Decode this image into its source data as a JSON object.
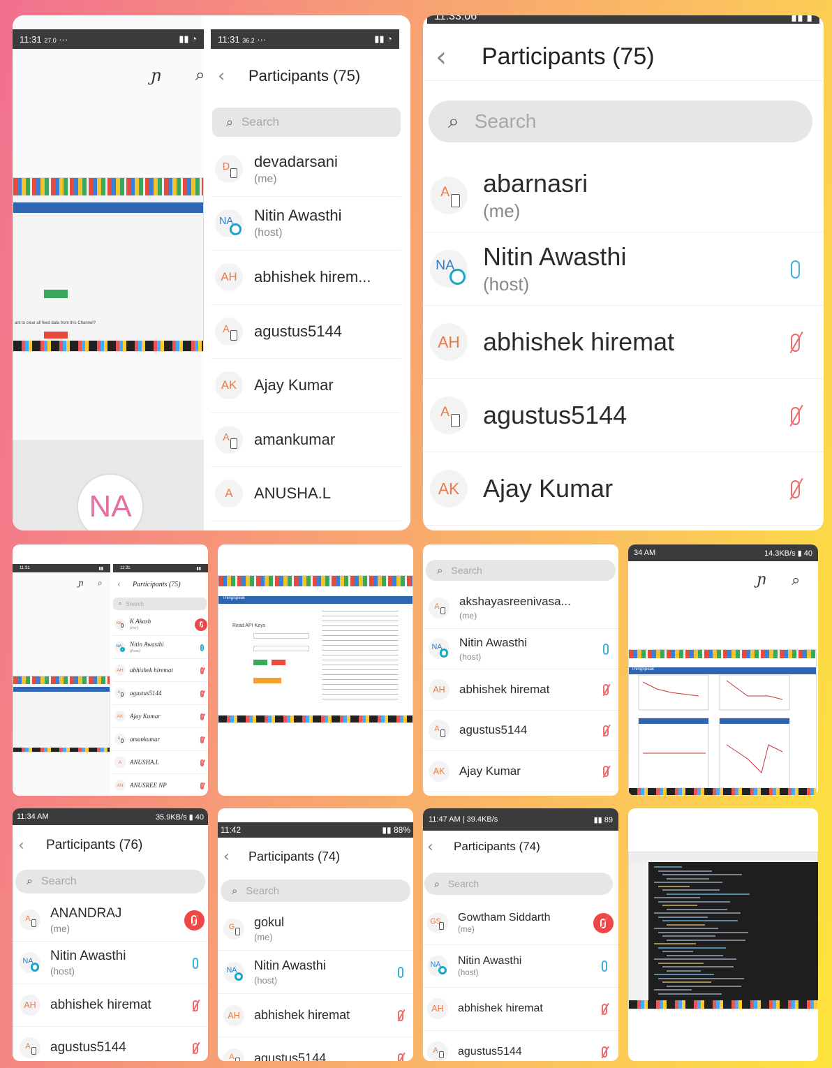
{
  "colors": {
    "accent_orange": "#e87a45",
    "mic_on": "#3db2d8",
    "mic_off": "#ec6b6b",
    "end_red": "#ee4747",
    "statusbar": "#3b3b3b"
  },
  "tile1": {
    "left_status": {
      "time": "11:31",
      "extra": "27.0"
    },
    "right_status": {
      "time": "11:31",
      "extra": "36.2"
    },
    "title": "Participants (75)",
    "search": "Search",
    "na_initials": "NA",
    "shot_text": "ant to clear all feed data from this Channel?",
    "participants": [
      {
        "initials": "D",
        "name": "devadarsani",
        "sub": "(me)",
        "type": "phone"
      },
      {
        "initials": "NA",
        "name": "Nitin Awasthi",
        "sub": "(host)",
        "type": "host"
      },
      {
        "initials": "AH",
        "name": "abhishek hirem...",
        "sub": "",
        "type": "initials"
      },
      {
        "initials": "A",
        "name": "agustus5144",
        "sub": "",
        "type": "phone"
      },
      {
        "initials": "AK",
        "name": "Ajay Kumar",
        "sub": "",
        "type": "initials"
      },
      {
        "initials": "A",
        "name": "amankumar",
        "sub": "",
        "type": "phone"
      },
      {
        "initials": "A",
        "name": "ANUSHA.L",
        "sub": "",
        "type": "initials"
      }
    ]
  },
  "tile2": {
    "status_time": "11:33:06",
    "title": "Participants (75)",
    "search": "Search",
    "participants": [
      {
        "initials": "A",
        "name": "abarnasri",
        "sub": "(me)",
        "type": "phone",
        "mic": ""
      },
      {
        "initials": "NA",
        "name": "Nitin Awasthi",
        "sub": "(host)",
        "type": "host",
        "mic": "on"
      },
      {
        "initials": "AH",
        "name": "abhishek hiremat",
        "sub": "",
        "type": "initials",
        "mic": "off"
      },
      {
        "initials": "A",
        "name": "agustus5144",
        "sub": "",
        "type": "phone",
        "mic": "off"
      },
      {
        "initials": "AK",
        "name": "Ajay Kumar",
        "sub": "",
        "type": "initials",
        "mic": "off"
      }
    ]
  },
  "tile3": {
    "title": "Participants (75)",
    "search": "Search",
    "participants": [
      {
        "initials": "KA",
        "name": "K Akash",
        "sub": "(me)",
        "type": "phone",
        "mic": "red"
      },
      {
        "initials": "NA",
        "name": "Nitin Awasthi",
        "sub": "(host)",
        "type": "host",
        "mic": "on"
      },
      {
        "initials": "AH",
        "name": "abhishek hiremat",
        "sub": "",
        "type": "initials",
        "mic": "off"
      },
      {
        "initials": "A",
        "name": "agustus5144",
        "sub": "",
        "type": "phone",
        "mic": "off"
      },
      {
        "initials": "AK",
        "name": "Ajay Kumar",
        "sub": "",
        "type": "initials",
        "mic": "off"
      },
      {
        "initials": "A",
        "name": "amankumar",
        "sub": "",
        "type": "phone",
        "mic": "off"
      },
      {
        "initials": "A",
        "name": "ANUSHA.L",
        "sub": "",
        "type": "initials",
        "mic": "off"
      },
      {
        "initials": "AN",
        "name": "ANUSREE NP",
        "sub": "",
        "type": "initials",
        "mic": "off"
      }
    ]
  },
  "tile4": {
    "brand": "ThingSpeak",
    "label": "Read API Keys"
  },
  "tile5": {
    "search": "Search",
    "participants": [
      {
        "initials": "A",
        "name": "akshayasreenivasa...",
        "sub": "(me)",
        "type": "phone",
        "mic": ""
      },
      {
        "initials": "NA",
        "name": "Nitin Awasthi",
        "sub": "(host)",
        "type": "host",
        "mic": "on"
      },
      {
        "initials": "AH",
        "name": "abhishek hiremat",
        "sub": "",
        "type": "initials",
        "mic": "off"
      },
      {
        "initials": "A",
        "name": "agustus5144",
        "sub": "",
        "type": "phone",
        "mic": "off"
      },
      {
        "initials": "AK",
        "name": "Ajay Kumar",
        "sub": "",
        "type": "initials",
        "mic": "off"
      }
    ]
  },
  "tile6": {
    "status_time": "34 AM",
    "status_speed": "14.3KB/s",
    "status_batt": "40",
    "brand": "ThingSpeak"
  },
  "tile7": {
    "status_time": "11:34 AM",
    "status_speed": "35.9KB/s",
    "status_batt": "40",
    "title": "Participants (76)",
    "search": "Search",
    "participants": [
      {
        "initials": "A",
        "name": "ANANDRAJ",
        "sub": "(me)",
        "type": "phone",
        "mic": "red"
      },
      {
        "initials": "NA",
        "name": "Nitin Awasthi",
        "sub": "(host)",
        "type": "host",
        "mic": "on"
      },
      {
        "initials": "AH",
        "name": "abhishek hiremat",
        "sub": "",
        "type": "initials",
        "mic": "off"
      },
      {
        "initials": "A",
        "name": "agustus5144",
        "sub": "",
        "type": "phone",
        "mic": "off"
      }
    ]
  },
  "tile8": {
    "status_time": "11:42",
    "status_batt": "88%",
    "title": "Participants (74)",
    "search": "Search",
    "participants": [
      {
        "initials": "G",
        "name": "gokul",
        "sub": "(me)",
        "type": "phone",
        "mic": ""
      },
      {
        "initials": "NA",
        "name": "Nitin Awasthi",
        "sub": "(host)",
        "type": "host",
        "mic": "on"
      },
      {
        "initials": "AH",
        "name": "abhishek hiremat",
        "sub": "",
        "type": "initials",
        "mic": "off"
      },
      {
        "initials": "A",
        "name": "agustus5144",
        "sub": "",
        "type": "phone",
        "mic": "off"
      }
    ]
  },
  "tile9": {
    "status_time": "11:47 AM | 39.4KB/s",
    "status_batt": "89",
    "title": "Participants (74)",
    "search": "Search",
    "participants": [
      {
        "initials": "GS",
        "name": "Gowtham Siddarth",
        "sub": "(me)",
        "type": "phone",
        "mic": "red"
      },
      {
        "initials": "NA",
        "name": "Nitin Awasthi",
        "sub": "(host)",
        "type": "host",
        "mic": "on"
      },
      {
        "initials": "AH",
        "name": "abhishek hiremat",
        "sub": "",
        "type": "initials",
        "mic": "off"
      },
      {
        "initials": "A",
        "name": "agustus5144",
        "sub": "",
        "type": "phone",
        "mic": "off"
      }
    ]
  }
}
